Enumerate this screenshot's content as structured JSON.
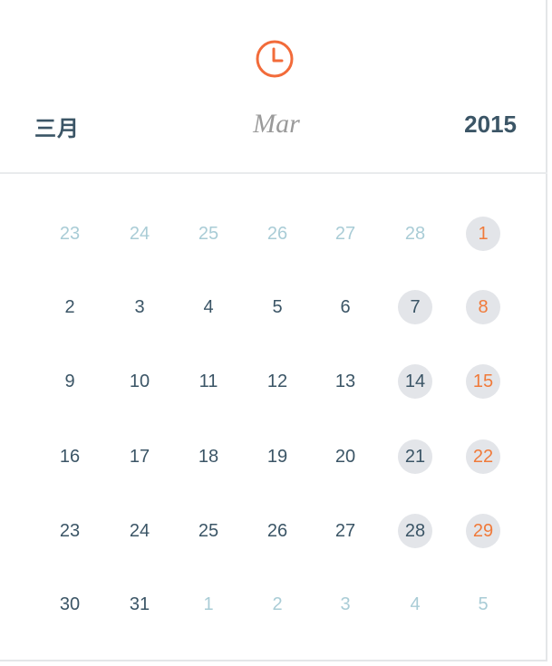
{
  "header": {
    "clock_icon": "clock-icon",
    "accent_color": "#f26b3a",
    "month_cn": "三月",
    "month_en": "Mar",
    "year": "2015"
  },
  "calendar": {
    "rows": [
      [
        {
          "d": "23",
          "m": 1
        },
        {
          "d": "24",
          "m": 1
        },
        {
          "d": "25",
          "m": 1
        },
        {
          "d": "26",
          "m": 1
        },
        {
          "d": "27",
          "m": 1
        },
        {
          "d": "28",
          "m": 1
        },
        {
          "d": "1",
          "w": 1,
          "s": 1
        }
      ],
      [
        {
          "d": "2"
        },
        {
          "d": "3"
        },
        {
          "d": "4"
        },
        {
          "d": "5"
        },
        {
          "d": "6"
        },
        {
          "d": "7",
          "w": 1
        },
        {
          "d": "8",
          "w": 1,
          "s": 1
        }
      ],
      [
        {
          "d": "9"
        },
        {
          "d": "10"
        },
        {
          "d": "11"
        },
        {
          "d": "12"
        },
        {
          "d": "13"
        },
        {
          "d": "14",
          "w": 1
        },
        {
          "d": "15",
          "w": 1,
          "s": 1
        }
      ],
      [
        {
          "d": "16"
        },
        {
          "d": "17"
        },
        {
          "d": "18"
        },
        {
          "d": "19"
        },
        {
          "d": "20"
        },
        {
          "d": "21",
          "w": 1
        },
        {
          "d": "22",
          "w": 1,
          "s": 1
        }
      ],
      [
        {
          "d": "23"
        },
        {
          "d": "24"
        },
        {
          "d": "25"
        },
        {
          "d": "26"
        },
        {
          "d": "27"
        },
        {
          "d": "28",
          "w": 1
        },
        {
          "d": "29",
          "w": 1,
          "s": 1
        }
      ],
      [
        {
          "d": "30"
        },
        {
          "d": "31"
        },
        {
          "d": "1",
          "m": 1
        },
        {
          "d": "2",
          "m": 1
        },
        {
          "d": "3",
          "m": 1
        },
        {
          "d": "4",
          "m": 1
        },
        {
          "d": "5",
          "m": 1
        }
      ]
    ]
  }
}
